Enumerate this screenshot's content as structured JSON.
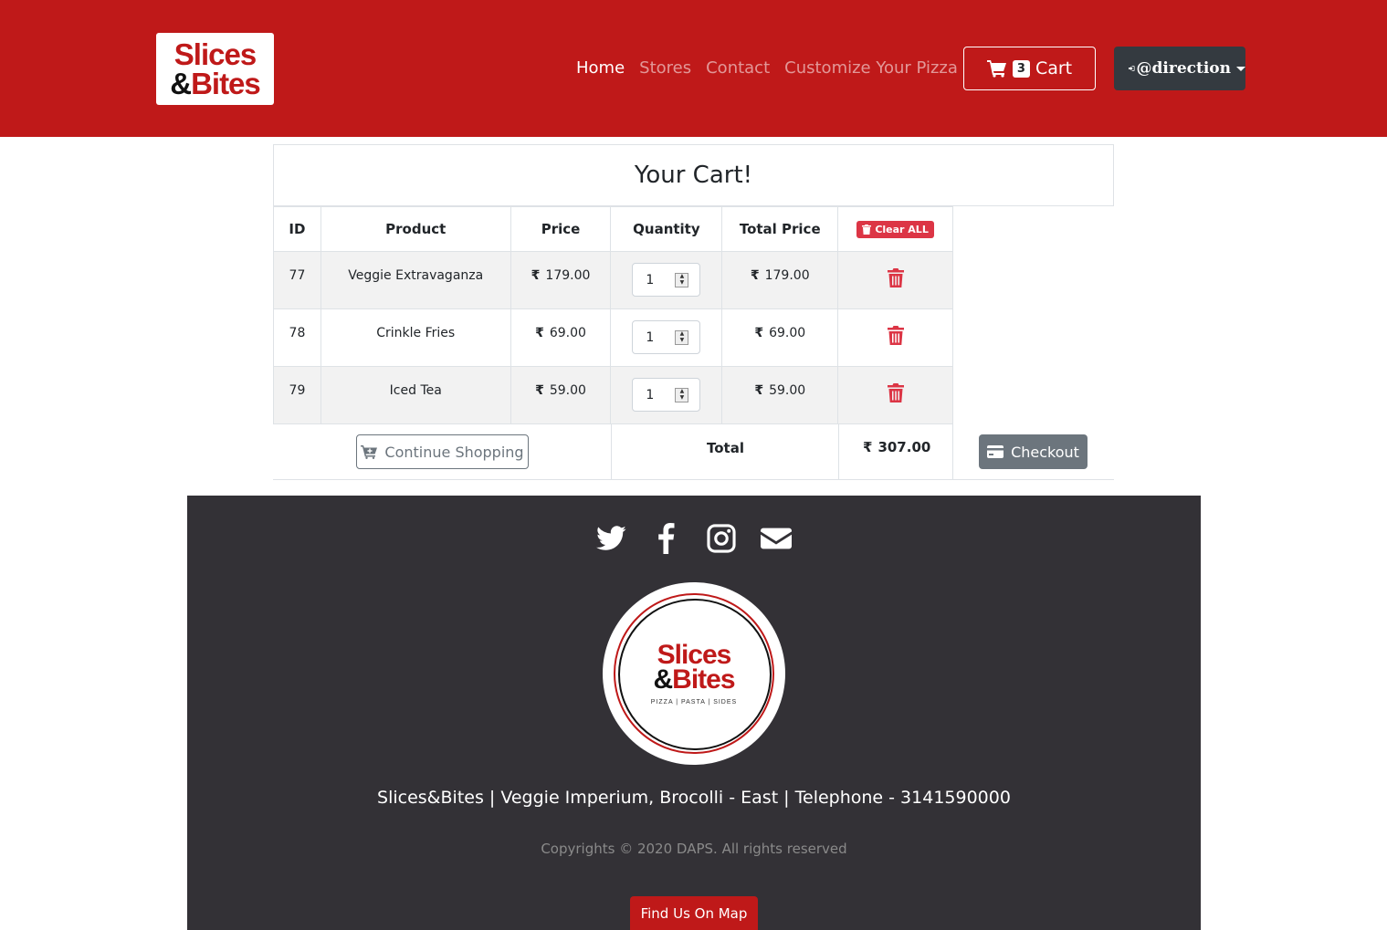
{
  "brand": {
    "line1": "Slices",
    "amp": "&",
    "line2": "Bites"
  },
  "nav": {
    "links": [
      {
        "label": "Home",
        "active": true
      },
      {
        "label": "Stores",
        "active": false
      },
      {
        "label": "Contact",
        "active": false
      },
      {
        "label": "Customize Your Pizza",
        "active": false
      }
    ],
    "cart": {
      "count": "3",
      "label": "Cart"
    },
    "user": {
      "label": "@direction"
    }
  },
  "cart": {
    "title": "Your Cart!",
    "headers": {
      "id": "ID",
      "product": "Product",
      "price": "Price",
      "quantity": "Quantity",
      "total": "Total Price",
      "clear": "Clear ALL"
    },
    "currency": "₹",
    "rows": [
      {
        "id": "77",
        "product": "Veggie Extravaganza",
        "price": "179.00",
        "qty": "1",
        "total": "179.00"
      },
      {
        "id": "78",
        "product": "Crinkle Fries",
        "price": "69.00",
        "qty": "1",
        "total": "69.00"
      },
      {
        "id": "79",
        "product": "Iced Tea",
        "price": "59.00",
        "qty": "1",
        "total": "59.00"
      }
    ],
    "continue_label": "Continue Shopping",
    "total_label": "Total",
    "grand_total": "307.00",
    "checkout_label": "Checkout"
  },
  "footer": {
    "logo": {
      "line1": "Slices",
      "amp": "&",
      "line2": "Bites",
      "tagline": "PIZZA | PASTA | SIDES"
    },
    "address": "Slices&Bites | Veggie Imperium, Brocolli - East | Telephone - 3141590000",
    "copyright": "Copyrights © 2020 DAPS. All rights reserved",
    "map_label": "Find Us On Map"
  },
  "colors": {
    "brand": "#bf1919",
    "dark": "#343a40",
    "footer_bg": "#333136",
    "danger": "#dc3545",
    "secondary": "#6c757d"
  }
}
